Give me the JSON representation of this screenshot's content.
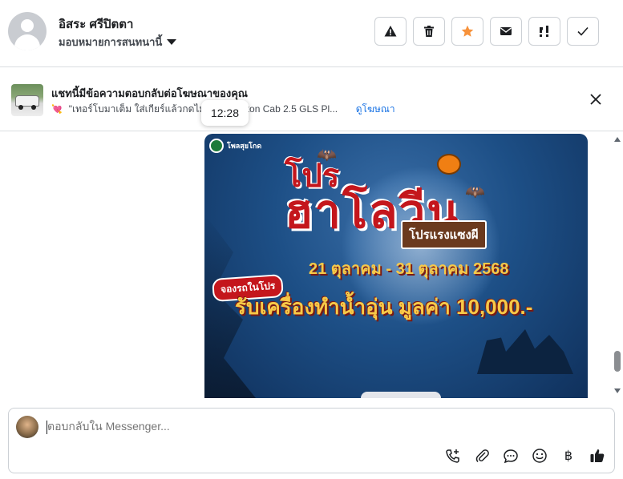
{
  "header": {
    "name": "อิสระ ศรีปิตตา",
    "assign_label": "มอบหมายการสนทนานี้",
    "actions": [
      {
        "name": "report-button",
        "icon": "warning-icon"
      },
      {
        "name": "delete-button",
        "icon": "trash-icon"
      },
      {
        "name": "star-button",
        "icon": "star-icon"
      },
      {
        "name": "mark-unread-button",
        "icon": "envelope-icon"
      },
      {
        "name": "follow-up-button",
        "icon": "follow-up-icon"
      },
      {
        "name": "mark-done-button",
        "icon": "check-icon"
      }
    ],
    "star_color": "#f7923b"
  },
  "ad": {
    "title": "แชทนี้มีข้อความตอบกลับต่อโฆษณาของคุณ",
    "text": "\"เทอร์โบมาเต็ม ใส่เกียร์แล้วกดไม่ต้องรอ Triton Cab 2.5 GLS Pl...",
    "link": "ดูโฆษณา"
  },
  "tooltip": "12:28",
  "promo": {
    "brand": "โพลสุยโกด",
    "title_small": "โปร",
    "title_big": "ฮาโลวีน",
    "sign": "โปรแรงแซงผี",
    "dates": "21 ตุลาคม - 31 ตุลาคม 2568",
    "badge": "จองรถในโปร",
    "offer": "รับเครื่องทำน้ำอุ่น มูลค่า 10,000.-"
  },
  "composer": {
    "placeholder": "ตอบกลับใน Messenger...",
    "tools": [
      "add-call-icon",
      "attachment-icon",
      "saved-reply-icon",
      "emoji-icon",
      "baht-icon",
      "like-icon"
    ],
    "baht_symbol": "฿"
  }
}
